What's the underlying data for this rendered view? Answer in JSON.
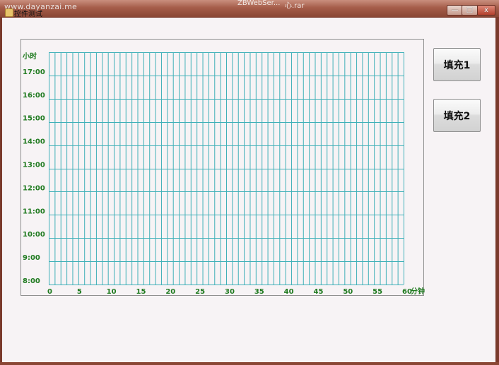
{
  "window": {
    "title": "控件测试",
    "watermark": "www.dayanzai.me",
    "taskbar_items": [
      "ZBWebSer...",
      "心.rar"
    ],
    "controls": {
      "minimize": "—",
      "maximize": "□",
      "close": "x"
    }
  },
  "buttons": {
    "fill1": "填充1",
    "fill2": "填充2"
  },
  "chart_data": {
    "type": "grid",
    "ylabel": "小时",
    "xlabel": "分钟",
    "y_ticks": [
      "8:00",
      "9:00",
      "10:00",
      "11:00",
      "12:00",
      "13:00",
      "14:00",
      "15:00",
      "16:00",
      "17:00"
    ],
    "x_ticks": [
      "0",
      "5",
      "10",
      "15",
      "20",
      "25",
      "30",
      "35",
      "40",
      "45",
      "50",
      "55",
      "60"
    ],
    "xlim": [
      0,
      60
    ],
    "ylim": [
      8,
      18
    ],
    "grid": true,
    "colors": {
      "grid": "#3fb0b8",
      "label": "#1f7a1f"
    }
  }
}
